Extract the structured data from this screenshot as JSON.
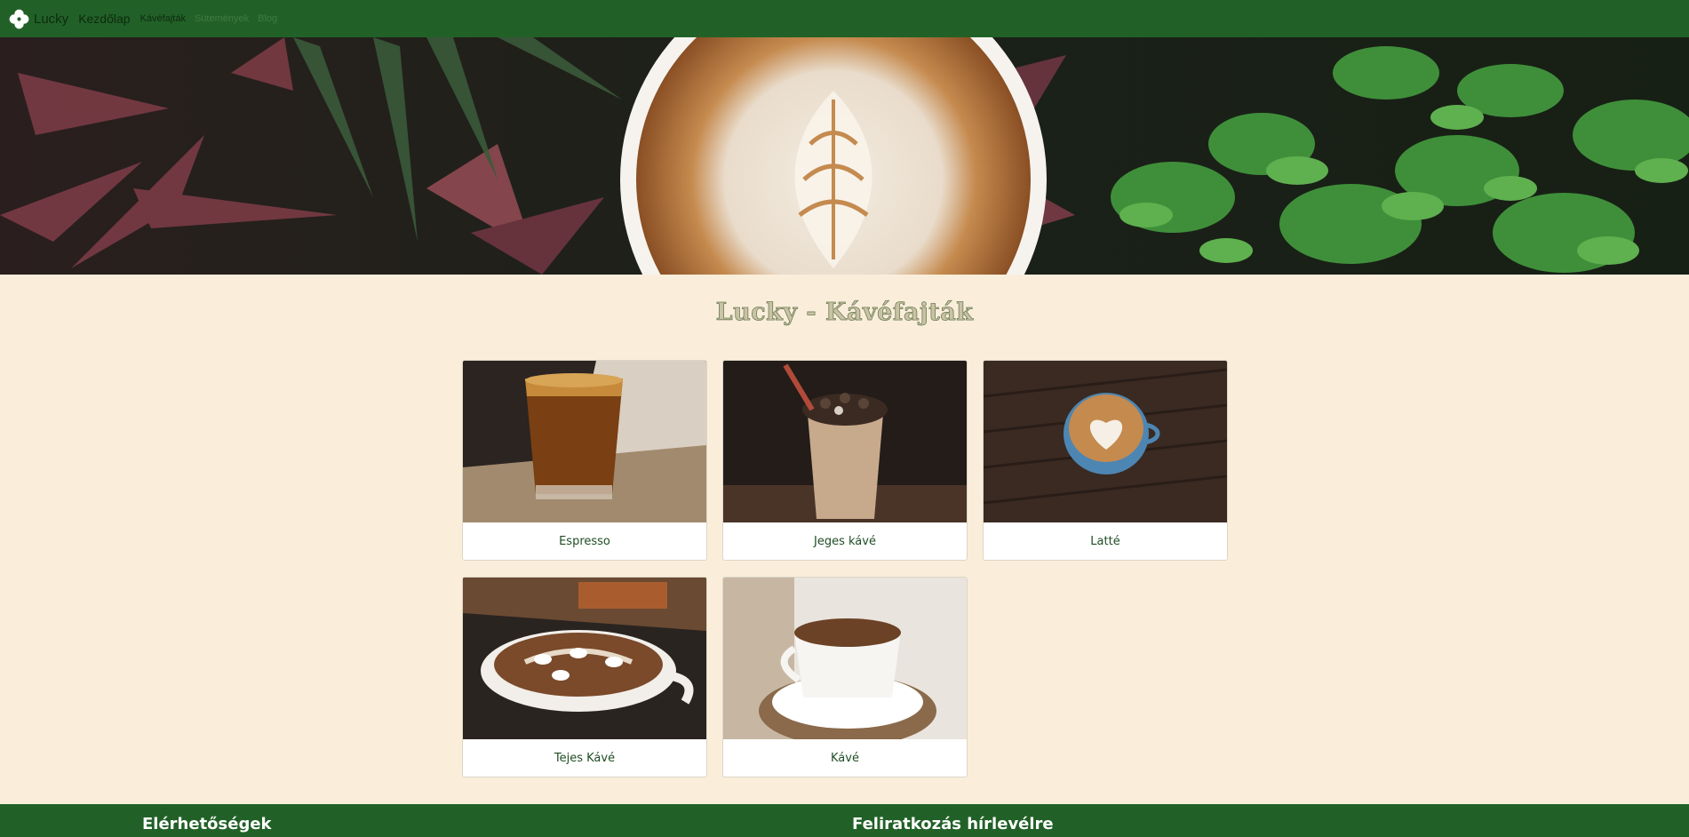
{
  "colors": {
    "navbar": "#216127",
    "page_background": "#faeedb",
    "card_label": "#1f4d24",
    "footer": "#216127"
  },
  "navbar": {
    "brand_icon": "clover-icon",
    "brand": "Lucky",
    "home": "Kezdőlap",
    "links": [
      {
        "label": "Kávéfajták",
        "active": true
      },
      {
        "label": "Sütemények",
        "active": false
      },
      {
        "label": "Blog",
        "active": false
      }
    ]
  },
  "page_title": "Lucky - Kávéfajták",
  "cards": [
    {
      "label": "Espresso"
    },
    {
      "label": "Jeges kávé"
    },
    {
      "label": "Latté"
    },
    {
      "label": "Tejes Kávé"
    },
    {
      "label": "Kávé"
    }
  ],
  "footer": {
    "contact_heading": "Elérhetőségek",
    "newsletter_heading": "Feliratkozás hírlevélre"
  }
}
